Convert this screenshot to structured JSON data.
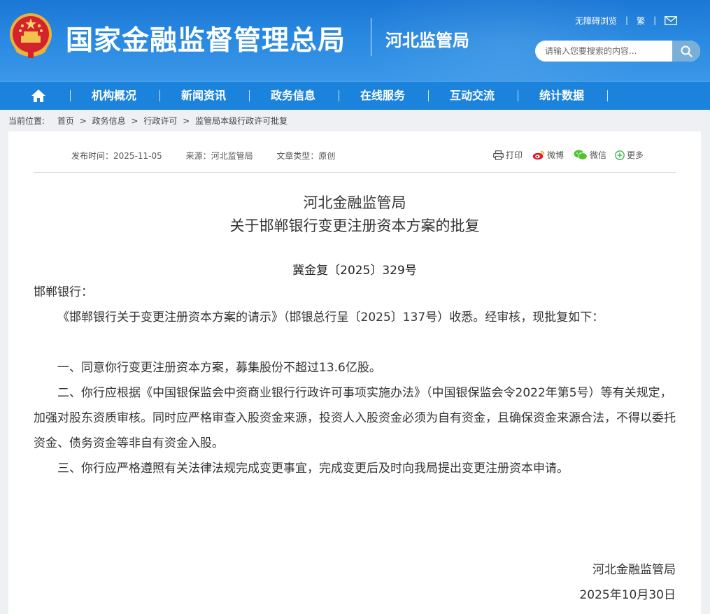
{
  "header": {
    "site_title": "国家金融监督管理总局",
    "sub_title": "河北监管局",
    "links": [
      "无障碍浏览",
      "繁"
    ],
    "mail_icon": "mail-icon",
    "search": {
      "placeholder": "请输入您要搜索的内容...",
      "button_icon": "search-icon"
    },
    "colors": {
      "header_blue": "#1b78d6",
      "nav_blue": "#1c83dc"
    }
  },
  "nav": {
    "home_icon": "home-icon",
    "items": [
      "机构概况",
      "新闻资讯",
      "政务信息",
      "在线服务",
      "互动交流",
      "统计数据"
    ]
  },
  "breadcrumb": {
    "label": "当前位置:",
    "items": [
      "首页",
      ">",
      "政务信息",
      ">",
      "行政许可",
      ">",
      "监管局本级行政许可批复"
    ]
  },
  "article": {
    "meta": {
      "publish": "发布时间：2025-11-05",
      "source": "来源：河北监管局",
      "type": "文章类型：原创"
    },
    "share": [
      "打印",
      "微博",
      "微信",
      "更多"
    ],
    "title_line1": "河北金融监管局",
    "title_line2": "关于邯郸银行变更注册资本方案的批复",
    "doc_no": "冀金复〔2025〕329号",
    "salutation": "邯郸银行：",
    "paragraphs": [
      "《邯郸银行关于变更注册资本方案的请示》（邯银总行呈〔2025〕137号）收悉。经审核，现批复如下：",
      "一、同意你行变更注册资本方案，募集股份不超过13.6亿股。",
      "二、你行应根据《中国银保监会中资商业银行行政许可事项实施办法》（中国银保监会令2022年第5号）等有关规定，加强对股东资质审核。同时应严格审查入股资金来源，投资人入股资金必须为自有资金，且确保资金来源合法，不得以委托资金、债务资金等非自有资金入股。",
      "三、你行应严格遵照有关法律法规完成变更事宜，完成变更后及时向我局提出变更注册资本申请。"
    ],
    "signature": "河北金融监管局",
    "date": "2025年10月30日"
  }
}
